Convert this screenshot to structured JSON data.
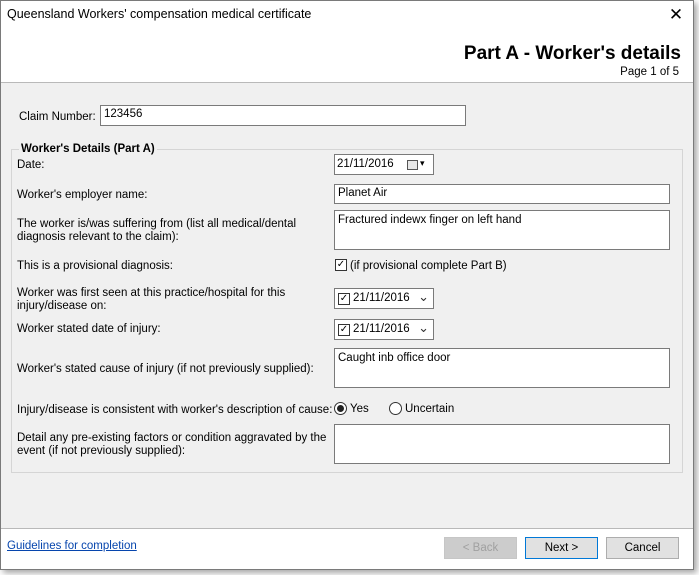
{
  "window": {
    "title": "Queensland Workers' compensation medical certificate",
    "close_glyph": "✕"
  },
  "header": {
    "part_title": "Part A - Worker's details",
    "page_indicator": "Page 1 of 5"
  },
  "claim": {
    "label": "Claim Number:",
    "value": "123456"
  },
  "group": {
    "title": "Worker's Details (Part A)"
  },
  "fields": {
    "date": {
      "label": "Date:",
      "value": "21/11/2016"
    },
    "employer": {
      "label": "Worker's employer name:",
      "value": "Planet Air"
    },
    "suffering": {
      "label_line1": "The worker is/was suffering from (list all medical/dental",
      "label_line2": "diagnosis relevant to the claim):",
      "value": "Fractured indewx finger on left hand"
    },
    "provisional": {
      "label": "This is a provisional diagnosis:",
      "checkbox_label": "(if provisional complete Part B)",
      "checked": true
    },
    "first_seen": {
      "label_line1": "Worker was first seen at this practice/hospital for this",
      "label_line2": "injury/disease on:",
      "value": "21/11/2016",
      "checked": true
    },
    "injury_date": {
      "label": "Worker stated date of injury:",
      "value": "21/11/2016",
      "checked": true
    },
    "cause": {
      "label": "Worker's stated cause of injury (if not previously supplied):",
      "value": "Caught inb office door"
    },
    "consistent": {
      "label": "Injury/disease is consistent with worker's description of cause:",
      "option_yes": "Yes",
      "option_uncertain": "Uncertain",
      "selected": "Yes"
    },
    "preexisting": {
      "label_line1": "Detail any pre-existing factors or condition aggravated by the",
      "label_line2": "event (if not previously supplied):",
      "value": ""
    }
  },
  "footer": {
    "guidelines_link": "Guidelines for completion",
    "back_label": "< Back",
    "next_label": "Next >",
    "cancel_label": "Cancel"
  },
  "icons": {
    "checkmark": "✓",
    "chevron_down": "⌄",
    "dropdown_arrow": "▾"
  }
}
